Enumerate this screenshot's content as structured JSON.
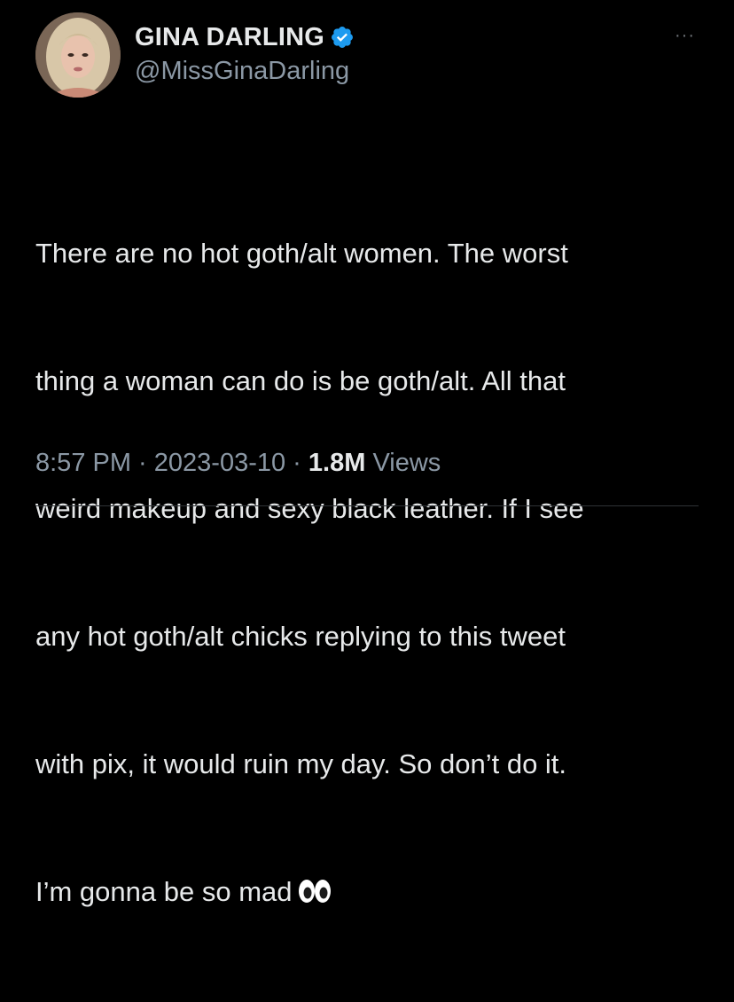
{
  "author": {
    "display_name": "GINA DARLING",
    "handle": "@MissGinaDarling",
    "verified": true,
    "avatar_icon": "profile-photo-icon"
  },
  "tweet": {
    "lines": [
      "There are no hot goth/alt women. The worst",
      "thing a woman can do is be goth/alt. All that",
      "weird makeup and sexy black leather.  If I see",
      "any hot goth/alt chicks replying to this tweet",
      "with pix, it would ruin my day. So don’t do it.",
      "I’m gonna be so mad"
    ],
    "trailing_emoji": "eyes-emoji"
  },
  "meta": {
    "time": "8:57 PM",
    "separator": " · ",
    "date": "2023-03-10",
    "views_count": "1.8M",
    "views_label": "Views"
  },
  "menu": {
    "more_label": "···"
  },
  "colors": {
    "background": "#000000",
    "primary_text": "#e7e9ea",
    "secondary_text": "#8b98a5",
    "verified_badge": "#1d9bf0"
  }
}
